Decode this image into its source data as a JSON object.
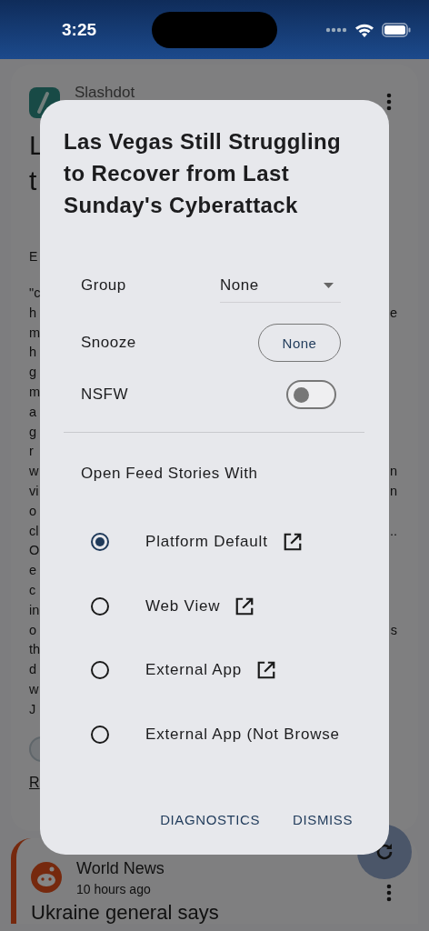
{
  "status_bar": {
    "time": "3:25"
  },
  "feed": [
    {
      "kind": "article",
      "source": "Slashdot",
      "headline_fragments": [
        "L",
        "t"
      ],
      "author_fragment": "E",
      "body_lines": [
        {
          "left": "\"c"
        },
        {
          "left": "h",
          "right": "e"
        },
        {
          "left": "m"
        },
        {
          "left": "h"
        },
        {
          "left": "g"
        },
        {
          "left": "m"
        },
        {
          "left": "a"
        },
        {
          "left": "g"
        },
        {
          "left": "r"
        },
        {
          "left": "w",
          "right": "n"
        },
        {
          "left": "vi",
          "right": "n"
        },
        {
          "left": "o"
        },
        {
          "left": "cl",
          "right": ".."
        },
        {
          "left": "O"
        },
        {
          "left": "e"
        },
        {
          "left": "c"
        },
        {
          "left": "in"
        },
        {
          "left": "o",
          "right": "s"
        },
        {
          "left": "th"
        },
        {
          "left": "d"
        },
        {
          "left": "w"
        },
        {
          "left": "J"
        }
      ],
      "link_fragment": "R"
    },
    {
      "kind": "reddit",
      "source": "World News",
      "time": "10 hours ago",
      "headline": "Ukraine general says"
    }
  ],
  "dialog": {
    "title": "Las Vegas Still Struggling to Recover from Last Sunday's Cyberattack",
    "group": {
      "label": "Group",
      "value": "None"
    },
    "snooze": {
      "label": "Snooze",
      "value": "None"
    },
    "nsfw": {
      "label": "NSFW",
      "on": false
    },
    "open_with": {
      "heading": "Open Feed Stories With",
      "options": [
        {
          "label": "Platform Default",
          "selected": true,
          "external": true
        },
        {
          "label": "Web View",
          "selected": false,
          "external": true
        },
        {
          "label": "External App",
          "selected": false,
          "external": true
        },
        {
          "label": "External App (Not Browse",
          "selected": false,
          "external": false
        }
      ]
    },
    "buttons": [
      "DIAGNOSTICS",
      "DISMISS"
    ]
  }
}
